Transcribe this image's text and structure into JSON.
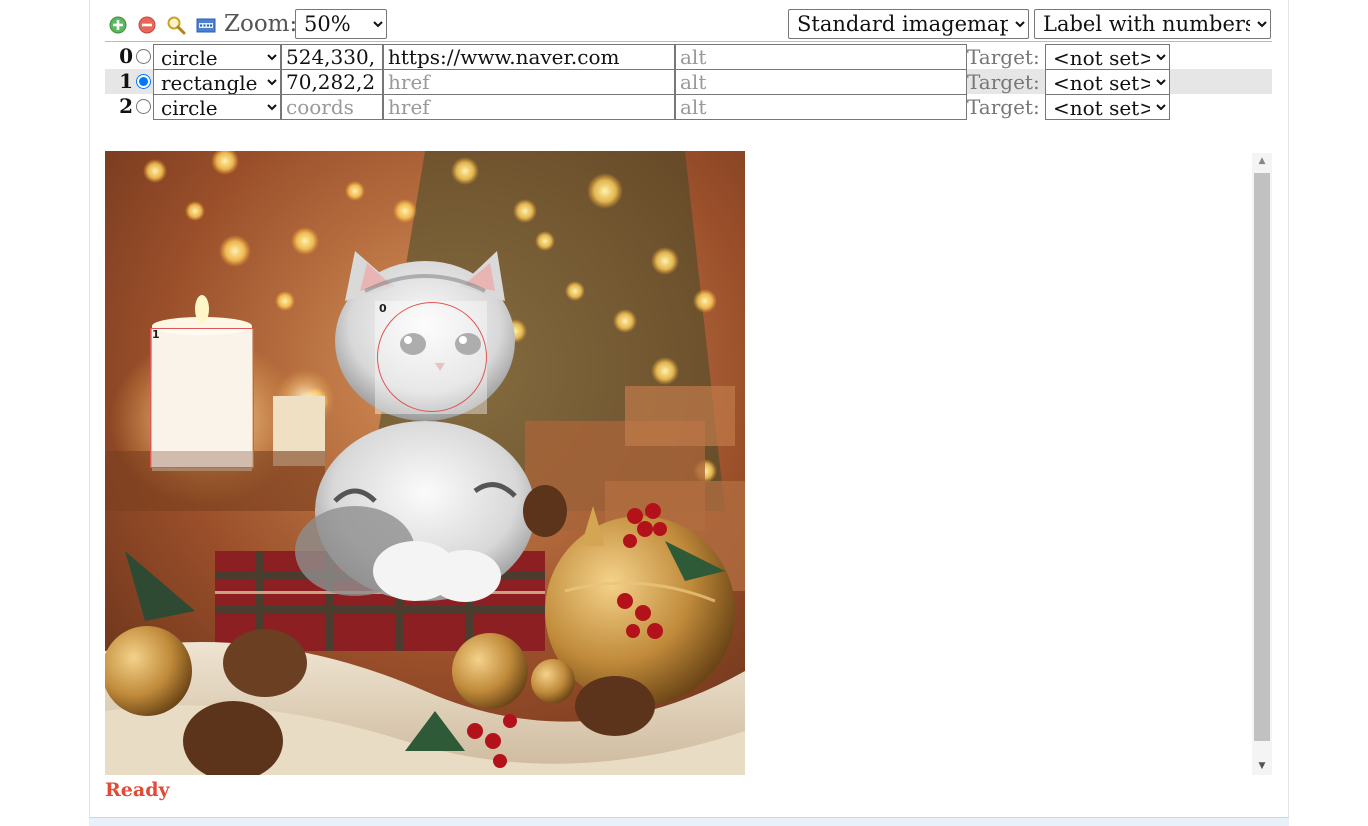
{
  "toolbar": {
    "zoom_label": "Zoom:",
    "zoom_value": "50%",
    "map_mode": "Standard imagemap",
    "label_mode": "Label with numbers"
  },
  "areas": [
    {
      "num": "0",
      "shape": "circle",
      "coords": "524,330,",
      "href": "https://www.naver.com",
      "href_placeholder": "href",
      "alt": "",
      "alt_placeholder": "alt",
      "target_label": "Target:",
      "target": "<not set>",
      "selected": false
    },
    {
      "num": "1",
      "shape": "rectangle",
      "coords": "70,282,2",
      "href": "",
      "href_placeholder": "href",
      "alt": "",
      "alt_placeholder": "alt",
      "target_label": "Target:",
      "target": "<not set>",
      "selected": true
    },
    {
      "num": "2",
      "shape": "circle",
      "coords": "",
      "coords_placeholder": "coords",
      "href": "",
      "href_placeholder": "href",
      "alt": "",
      "alt_placeholder": "alt",
      "target_label": "Target:",
      "target": "<not set>",
      "selected": false
    }
  ],
  "canvas": {
    "area_labels": [
      "0",
      "1"
    ]
  },
  "status": {
    "text": "Ready",
    "color": "#e24a33"
  },
  "icons": [
    "add-area-icon",
    "delete-area-icon",
    "preview-icon",
    "html-code-icon"
  ],
  "colors": {
    "area_outline": "#e05555",
    "selected_row": "#e6e6e6"
  }
}
